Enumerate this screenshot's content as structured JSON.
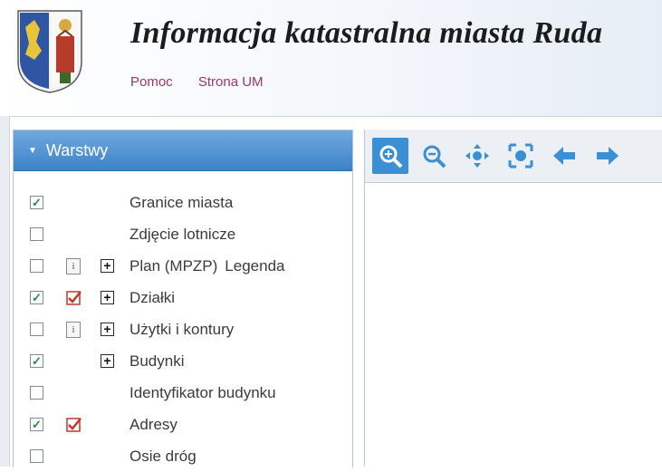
{
  "header": {
    "title": "Informacja katastralna miasta Ruda",
    "links": [
      {
        "label": "Pomoc"
      },
      {
        "label": "Strona UM"
      }
    ]
  },
  "layers_panel": {
    "title": "Warstwy",
    "items": [
      {
        "label": "Granice miasta",
        "checked": true,
        "info_icon": "none",
        "expand": false,
        "extra": ""
      },
      {
        "label": "Zdjęcie lotnicze",
        "checked": false,
        "info_icon": "none",
        "expand": false,
        "extra": ""
      },
      {
        "label": "Plan (MPZP)",
        "checked": false,
        "info_icon": "info",
        "expand": true,
        "extra": "Legenda"
      },
      {
        "label": "Działki",
        "checked": true,
        "info_icon": "legend",
        "expand": true,
        "extra": ""
      },
      {
        "label": "Użytki i kontury",
        "checked": false,
        "info_icon": "info",
        "expand": true,
        "extra": ""
      },
      {
        "label": "Budynki",
        "checked": true,
        "info_icon": "none",
        "expand": true,
        "extra": ""
      },
      {
        "label": "Identyfikator budynku",
        "checked": false,
        "info_icon": "none",
        "expand": false,
        "extra": ""
      },
      {
        "label": "Adresy",
        "checked": true,
        "info_icon": "legend",
        "expand": false,
        "extra": ""
      },
      {
        "label": "Osie dróg",
        "checked": false,
        "info_icon": "none",
        "expand": false,
        "extra": ""
      }
    ]
  },
  "toolbar": {
    "tools": [
      {
        "icon": "zoom-in-icon",
        "active": true
      },
      {
        "icon": "zoom-out-icon",
        "active": false
      },
      {
        "icon": "pan-icon",
        "active": false
      },
      {
        "icon": "zoom-extent-icon",
        "active": false
      },
      {
        "icon": "back-arrow-icon",
        "active": false
      },
      {
        "icon": "forward-arrow-icon",
        "active": false
      }
    ]
  },
  "colors": {
    "accent": "#3b8fd4",
    "link": "#a0356b",
    "panel_header": "#4f93d2"
  }
}
